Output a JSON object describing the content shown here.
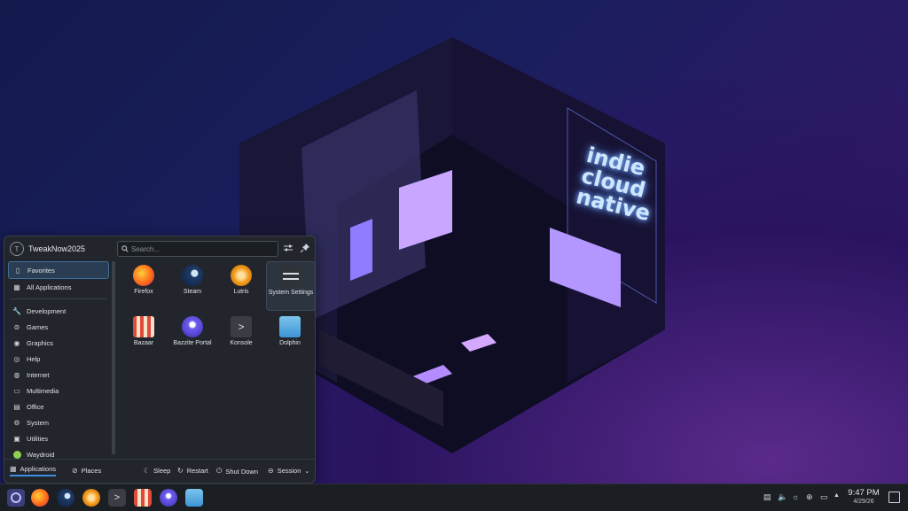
{
  "menu": {
    "username": "TweakNow2025",
    "search_placeholder": "Search...",
    "sidebar": [
      {
        "label": "Favorites",
        "icon": "favorites-icon",
        "selected": true
      },
      {
        "label": "All Applications",
        "icon": "grid-icon"
      },
      {
        "label": "Development",
        "icon": "wrench-icon"
      },
      {
        "label": "Games",
        "icon": "gamepad-icon"
      },
      {
        "label": "Graphics",
        "icon": "palette-icon"
      },
      {
        "label": "Help",
        "icon": "help-icon"
      },
      {
        "label": "Internet",
        "icon": "globe-icon"
      },
      {
        "label": "Multimedia",
        "icon": "monitor-icon"
      },
      {
        "label": "Office",
        "icon": "document-icon"
      },
      {
        "label": "System",
        "icon": "gear-icon"
      },
      {
        "label": "Utilities",
        "icon": "toolbox-icon"
      },
      {
        "label": "Waydroid",
        "icon": "waydroid-icon"
      }
    ],
    "apps": [
      {
        "label": "Firefox",
        "icon": "firefox-icon"
      },
      {
        "label": "Steam",
        "icon": "steam-icon"
      },
      {
        "label": "Lutris",
        "icon": "lutris-icon"
      },
      {
        "label": "System Settings",
        "icon": "settings-icon"
      },
      {
        "label": "Bazaar",
        "icon": "bazaar-icon"
      },
      {
        "label": "Bazzite Portal",
        "icon": "bazzite-portal-icon"
      },
      {
        "label": "Konsole",
        "icon": "konsole-icon"
      },
      {
        "label": "Dolphin",
        "icon": "dolphin-icon"
      }
    ],
    "footer": {
      "applications": "Applications",
      "places": "Places",
      "sleep": "Sleep",
      "restart": "Restart",
      "shutdown": "Shut Down",
      "session": "Session"
    }
  },
  "wallpaper": {
    "neon_line1": "indie",
    "neon_line2": "cloud",
    "neon_line3": "native"
  },
  "taskbar": {
    "time": "9:47 PM",
    "date": "4/29/26",
    "apps": [
      "bazzite-launcher-icon",
      "firefox-icon",
      "steam-icon",
      "lutris-icon",
      "konsole-icon",
      "bazaar-icon",
      "bazzite-portal-icon",
      "dolphin-icon"
    ]
  },
  "colors": {
    "accent": "#3d8ee0",
    "panel": "#22262c",
    "taskbar": "#1b1e23"
  }
}
